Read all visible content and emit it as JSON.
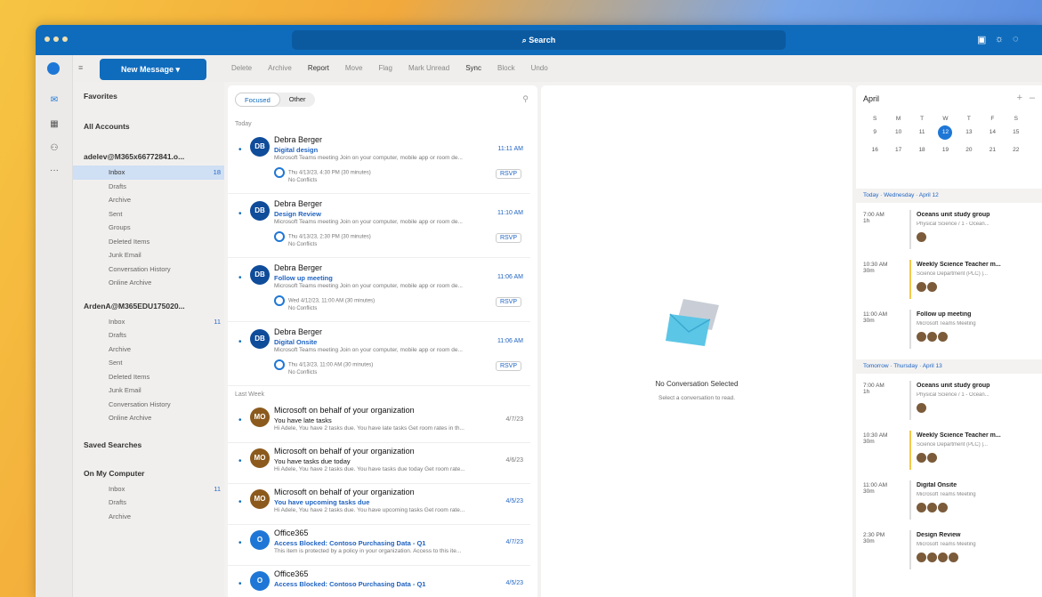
{
  "title": {
    "search": "Search"
  },
  "toolbar": {
    "new_message": "New Message",
    "items": [
      "Delete",
      "Archive",
      "Report",
      "Move",
      "Flag",
      "Mark Unread",
      "Sync",
      "Block",
      "Undo"
    ]
  },
  "sidebar": {
    "favorites": "Favorites",
    "all_accounts": "All Accounts",
    "account1": "adelev@M365x66772841.o...",
    "folders1": [
      "Inbox",
      "Drafts",
      "Archive",
      "Sent",
      "Groups",
      "Deleted Items",
      "Junk Email",
      "Conversation History",
      "Online Archive"
    ],
    "inbox1_count": "18",
    "account2": "ArdenA@M365EDU175020...",
    "folders2": [
      "Inbox",
      "Drafts",
      "Archive",
      "Sent",
      "Deleted Items",
      "Junk Email",
      "Conversation History",
      "Online Archive"
    ],
    "inbox2_count": "11",
    "saved": "Saved Searches",
    "on_my_computer": "On My Computer",
    "folders3": [
      "Inbox",
      "Drafts",
      "Archive"
    ],
    "inbox3_count": "11"
  },
  "list": {
    "tab_focused": "Focused",
    "tab_other": "Other",
    "today": "Today",
    "last_week": "Last Week",
    "messages": [
      {
        "initials": "DB",
        "sender": "Debra Berger",
        "subject": "Digital design",
        "time": "11:11 AM",
        "preview": "Microsoft Teams meeting Join on your computer, mobile app or room de...",
        "meta": "Thu 4/13/23, 4:30 PM (30 minutes)",
        "meta2": "No Conflicts",
        "rsvp": "RSVP"
      },
      {
        "initials": "DB",
        "sender": "Debra Berger",
        "subject": "Design Review",
        "time": "11:10 AM",
        "preview": "Microsoft Teams meeting Join on your computer, mobile app or room de...",
        "meta": "Thu 4/13/23, 2:30 PM (30 minutes)",
        "meta2": "No Conflicts",
        "rsvp": "RSVP"
      },
      {
        "initials": "DB",
        "sender": "Debra Berger",
        "subject": "Follow up meeting",
        "time": "11:06 AM",
        "preview": "Microsoft Teams meeting Join on your computer, mobile app or room de...",
        "meta": "Wed 4/12/23, 11:00 AM (30 minutes)",
        "meta2": "No Conflicts",
        "rsvp": "RSVP"
      },
      {
        "initials": "DB",
        "sender": "Debra Berger",
        "subject": "Digital Onsite",
        "time": "11:06 AM",
        "preview": "Microsoft Teams meeting Join on your computer, mobile app or room de...",
        "meta": "Thu 4/13/23, 11:00 AM (30 minutes)",
        "meta2": "No Conflicts",
        "rsvp": "RSVP"
      }
    ],
    "older": [
      {
        "initials": "MO",
        "sender": "Microsoft on behalf of your organization",
        "subject": "You have late tasks",
        "time": "4/7/23",
        "preview": "Hi Adele, You have 2 tasks due. You have late tasks Get room rates in th..."
      },
      {
        "initials": "MO",
        "sender": "Microsoft on behalf of your organization",
        "subject": "You have tasks due today",
        "time": "4/6/23",
        "preview": "Hi Adele, You have 2 tasks due. You have tasks due today Get room rate..."
      },
      {
        "initials": "MO",
        "sender": "Microsoft on behalf of your organization",
        "subject": "You have upcoming tasks due",
        "time": "4/5/23",
        "preview": "Hi Adele, You have 2 tasks due. You have upcoming tasks Get room rate..."
      },
      {
        "initials": "O",
        "sender": "Office365",
        "subject": "Access Blocked: Contoso Purchasing Data - Q1",
        "time": "4/7/23",
        "preview": "This item is protected by a policy in your organization. Access to this ite..."
      },
      {
        "initials": "O",
        "sender": "Office365",
        "subject": "Access Blocked: Contoso Purchasing Data - Q1",
        "time": "4/5/23",
        "preview": ""
      }
    ]
  },
  "reading": {
    "title": "No Conversation Selected",
    "subtitle": "Select a conversation to read."
  },
  "calendar": {
    "month": "April",
    "weekdays": [
      "S",
      "M",
      "T",
      "W",
      "T",
      "F",
      "S"
    ],
    "row1": [
      "S",
      "9",
      "10",
      "11",
      "12",
      "13",
      "14",
      "15"
    ],
    "today_label": "Today · Wednesday · April 12",
    "tomorrow_label": "Tomorrow · Thursday · April 13",
    "events_today": [
      {
        "time": "7:00 AM",
        "dur": "1h",
        "name": "Oceans unit study group",
        "loc": "Physical Science / 1 - Ocean..."
      },
      {
        "time": "10:30 AM",
        "dur": "30m",
        "name": "Weekly Science Teacher m...",
        "loc": "Science Department (PLC) |..."
      },
      {
        "time": "11:00 AM",
        "dur": "30m",
        "name": "Follow up meeting",
        "loc": "Microsoft Teams Meeting"
      }
    ],
    "events_tomorrow": [
      {
        "time": "7:00 AM",
        "dur": "1h",
        "name": "Oceans unit study group",
        "loc": "Physical Science / 1 - Ocean..."
      },
      {
        "time": "10:30 AM",
        "dur": "30m",
        "name": "Weekly Science Teacher m...",
        "loc": "Science Department (PLC) |..."
      },
      {
        "time": "11:00 AM",
        "dur": "30m",
        "name": "Digital Onsite",
        "loc": "Microsoft Teams Meeting"
      },
      {
        "time": "2:30 PM",
        "dur": "30m",
        "name": "Design Review",
        "loc": "Microsoft Teams Meeting"
      }
    ]
  }
}
